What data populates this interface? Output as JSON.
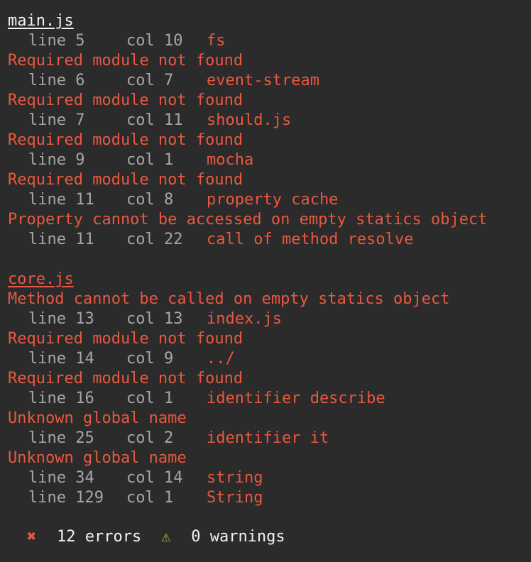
{
  "files": [
    {
      "name": "main.js",
      "color": "#f2f2f2",
      "entries": [
        {
          "kind": "loc",
          "line": "line 5",
          "col": "col 10",
          "sym": "fs"
        },
        {
          "kind": "msg",
          "text": "Required module not found"
        },
        {
          "kind": "loc",
          "line": "line 6",
          "col": "col 7",
          "sym": "event-stream"
        },
        {
          "kind": "msg",
          "text": "Required module not found"
        },
        {
          "kind": "loc",
          "line": "line 7",
          "col": "col 11",
          "sym": "should.js"
        },
        {
          "kind": "msg",
          "text": "Required module not found"
        },
        {
          "kind": "loc",
          "line": "line 9",
          "col": "col 1",
          "sym": "mocha"
        },
        {
          "kind": "msg",
          "text": "Required module not found"
        },
        {
          "kind": "loc",
          "line": "line 11",
          "col": "col 8",
          "sym": "property cache"
        },
        {
          "kind": "msg",
          "text": "Property cannot be accessed on empty statics object"
        },
        {
          "kind": "loc",
          "line": "line 11",
          "col": "col 22",
          "sym": "call of method resolve"
        }
      ]
    },
    {
      "name": "core.js",
      "color": "#e8583f",
      "entries": [
        {
          "kind": "msg",
          "text": "Method cannot be called on empty statics object"
        },
        {
          "kind": "loc",
          "line": "line 13",
          "col": "col 13",
          "sym": "index.js"
        },
        {
          "kind": "msg",
          "text": "Required module not found"
        },
        {
          "kind": "loc",
          "line": "line 14",
          "col": "col 9",
          "sym": "../"
        },
        {
          "kind": "msg",
          "text": "Required module not found"
        },
        {
          "kind": "loc",
          "line": "line 16",
          "col": "col 1",
          "sym": "identifier describe"
        },
        {
          "kind": "msg",
          "text": "Unknown global name"
        },
        {
          "kind": "loc",
          "line": "line 25",
          "col": "col 2",
          "sym": "identifier it"
        },
        {
          "kind": "msg",
          "text": "Unknown global name"
        },
        {
          "kind": "loc",
          "line": "line 34",
          "col": "col 14",
          "sym": "string"
        },
        {
          "kind": "loc",
          "line": "line 129",
          "col": "col 1",
          "sym": "String"
        }
      ]
    }
  ],
  "summary": {
    "error_icon": "✖",
    "errors": "12 errors",
    "warning_icon": "⚠",
    "warnings": "0 warnings"
  },
  "colors": {
    "background": "#2b2b2b",
    "error": "#e8583f",
    "dim": "#a6a6a6",
    "warning": "#c9c22a"
  }
}
